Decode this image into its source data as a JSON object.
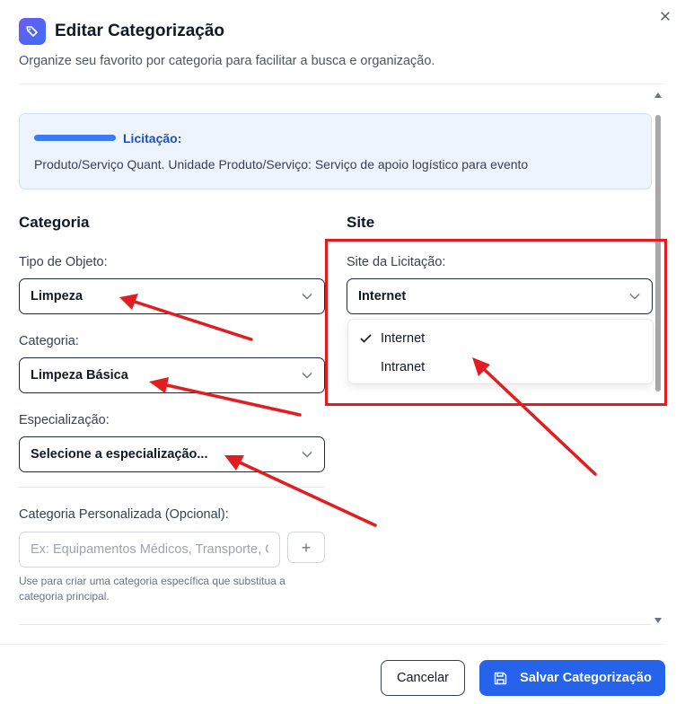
{
  "header": {
    "title": "Editar Categorização",
    "subtitle": "Organize seu favorito por categoria para facilitar a busca e organização."
  },
  "info": {
    "label": "Licitação:",
    "text": "Produto/Serviço Quant. Unidade Produto/Serviço: Serviço de apoio logístico para evento"
  },
  "categoria": {
    "section_title": "Categoria",
    "tipo_objeto": {
      "label": "Tipo de Objeto:",
      "value": "Limpeza"
    },
    "categoria": {
      "label": "Categoria:",
      "value": "Limpeza Básica"
    },
    "especializacao": {
      "label": "Especialização:",
      "value": "Selecione a especialização..."
    },
    "personalizada": {
      "label": "Categoria Personalizada (Opcional):",
      "placeholder": "Ex: Equipamentos Médicos, Transporte, Consultoria",
      "add_symbol": "+",
      "help": "Use para criar uma categoria específica que substitua a categoria principal."
    }
  },
  "site": {
    "section_title": "Site",
    "label": "Site da Licitação:",
    "value": "Internet",
    "options": [
      {
        "label": "Internet",
        "selected": true
      },
      {
        "label": "Intranet",
        "selected": false
      }
    ]
  },
  "footer": {
    "cancel": "Cancelar",
    "save": "Salvar Categorização"
  },
  "colors": {
    "primary": "#2563eb",
    "annotation_red": "#e11d22",
    "info_bg": "#eef4fe"
  },
  "icons": {
    "title": "tag-icon",
    "close": "close-icon",
    "chevron": "chevron-down-icon",
    "check": "check-icon",
    "save": "save-icon",
    "add": "plus-icon"
  }
}
